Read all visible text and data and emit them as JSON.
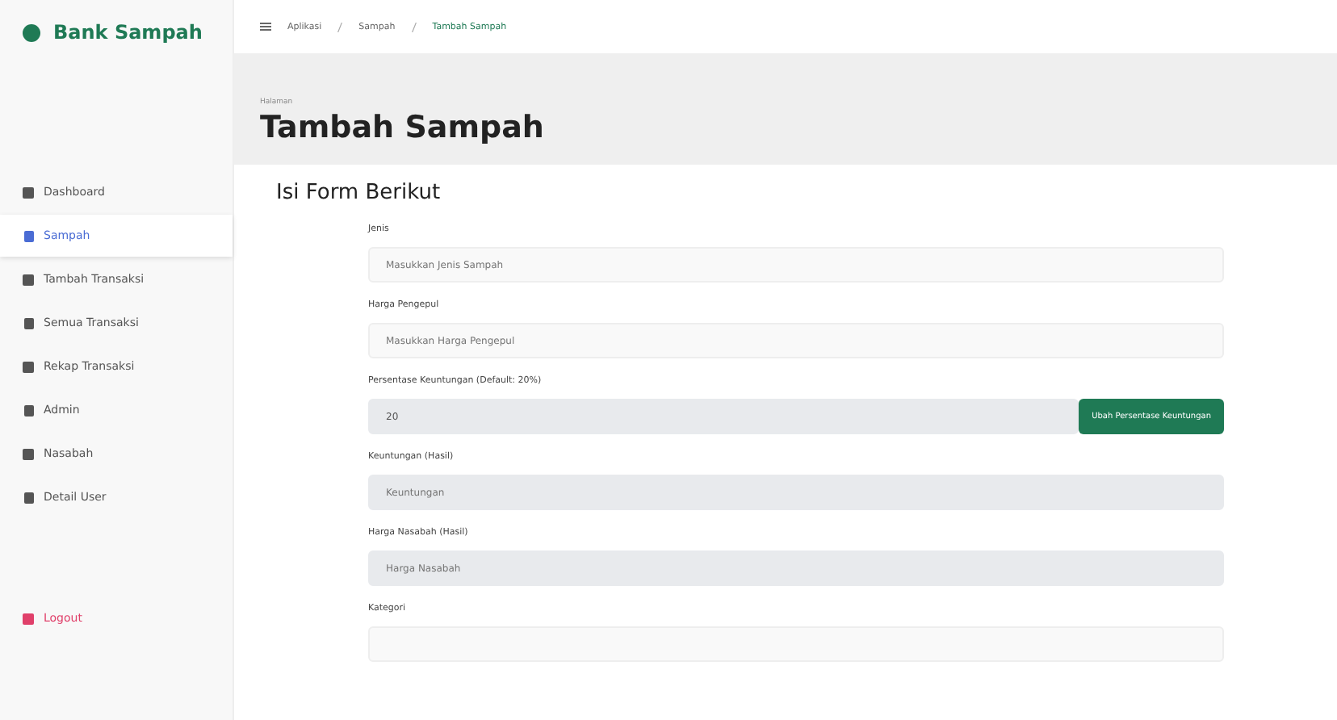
{
  "brand": "Bank Sampah",
  "breadcrumb": [
    "Aplikasi",
    "Sampah",
    "Tambah Sampah"
  ],
  "sidebar": {
    "items": [
      {
        "label": "Dashboard",
        "selected": false,
        "kind": "nav"
      },
      {
        "label": "Sampah",
        "selected": true,
        "kind": "nav"
      },
      {
        "label": "Tambah Transaksi",
        "selected": false,
        "kind": "nav"
      },
      {
        "label": "Semua Transaksi",
        "selected": false,
        "kind": "nav"
      },
      {
        "label": "Rekap Transaksi",
        "selected": false,
        "kind": "nav"
      },
      {
        "label": "Admin",
        "selected": false,
        "kind": "nav"
      },
      {
        "label": "Nasabah",
        "selected": false,
        "kind": "nav"
      },
      {
        "label": "Detail User",
        "selected": false,
        "kind": "nav"
      },
      {
        "label": "Logout",
        "selected": false,
        "kind": "logout"
      }
    ]
  },
  "page": {
    "pretitle": "Halaman",
    "title": "Tambah Sampah"
  },
  "form": {
    "title": "Isi Form Berikut",
    "fields": [
      {
        "label": "Jenis",
        "placeholder": "Masukkan Jenis Sampah",
        "disabled": false
      },
      {
        "label": "Harga Pengepul",
        "placeholder": "Masukkan Harga Pengepul",
        "disabled": false
      },
      {
        "label": "Persentase Keuntungan (Default: 20%)",
        "value": "20",
        "disabled": true,
        "button": "Ubah Persentase Keuntungan"
      },
      {
        "label": "Keuntungan (Hasil)",
        "placeholder": "Keuntungan",
        "disabled": true
      },
      {
        "label": "Harga Nasabah (Hasil)",
        "placeholder": "Harga Nasabah",
        "disabled": true
      },
      {
        "label": "Kategori",
        "disabled": false
      }
    ]
  }
}
